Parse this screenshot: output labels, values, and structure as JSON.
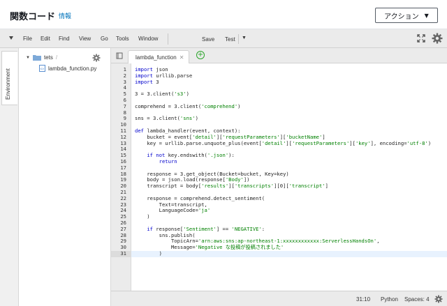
{
  "header": {
    "title": "関数コード",
    "info_link": "情報",
    "action_button": "アクション"
  },
  "menubar": {
    "items": [
      "File",
      "Edit",
      "Find",
      "View",
      "Go",
      "Tools",
      "Window"
    ],
    "save": "Save",
    "test": "Test"
  },
  "sidebar": {
    "tab_label": "Environment"
  },
  "tree": {
    "folder_name": "tets",
    "folder_path": "/",
    "file_name": "lambda_function.py"
  },
  "editor": {
    "tab_label": "lambda_function",
    "lines": [
      "import json",
      "import urllib.parse",
      "import boto3",
      "",
      "s3 = boto3.client('s3')",
      "",
      "comprehend = boto3.client('comprehend')",
      "",
      "sns = boto3.client('sns')",
      "",
      "def lambda_handler(event, context):",
      "    bucket = event['detail']['requestParameters']['bucketName']",
      "    key = urllib.parse.unquote_plus(event['detail']['requestParameters']['key'], encoding='utf-8')",
      "",
      "    if not key.endswith('.json'):",
      "        return",
      "",
      "    response = s3.get_object(Bucket=bucket, Key=key)",
      "    body = json.load(response['Body'])",
      "    transcript = body['results']['transcripts'][0]['transcript']",
      "",
      "    response = comprehend.detect_sentiment(",
      "        Text=transcript,",
      "        LanguageCode='ja'",
      "    )",
      "",
      "    if response['Sentiment'] == 'NEGATIVE':",
      "        sns.publish(",
      "            TopicArn='arn:aws:sns:ap-northeast-1:xxxxxxxxxxxx:ServerlessHandsOn',",
      "            Message='Negative な投稿が投稿されました'",
      "        )"
    ]
  },
  "status": {
    "position": "31:10",
    "language": "Python",
    "spaces": "Spaces: 4"
  },
  "colors": {
    "keyword": "#0000cc",
    "string": "#008000",
    "link": "#0073bb"
  }
}
